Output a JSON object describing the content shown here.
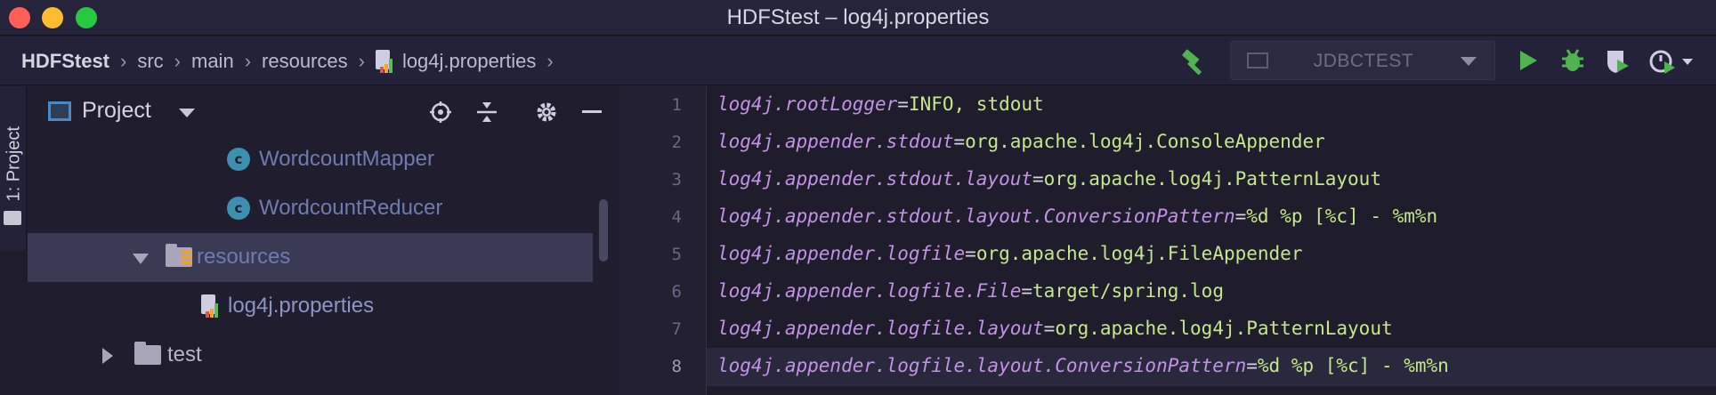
{
  "window": {
    "title": "HDFStest – log4j.properties"
  },
  "breadcrumb": {
    "items": [
      "HDFStest",
      "src",
      "main",
      "resources",
      "log4j.properties"
    ]
  },
  "toolbar": {
    "run_config_label": "JDBCTEST",
    "icons": [
      "build-hammer-icon",
      "run-icon",
      "debug-icon",
      "coverage-icon",
      "profile-icon"
    ]
  },
  "tool_strip": {
    "label": "1: Project"
  },
  "project_panel": {
    "title": "Project",
    "header_icons": [
      "locate-icon",
      "collapse-icon",
      "settings-gear-icon",
      "hide-icon"
    ],
    "tree": [
      {
        "label": "WordcountMapper",
        "kind": "class",
        "badge": "c"
      },
      {
        "label": "WordcountReducer",
        "kind": "class",
        "badge": "c"
      },
      {
        "label": "resources",
        "kind": "folder",
        "expanded": true,
        "selected": true
      },
      {
        "label": "log4j.properties",
        "kind": "properties-file"
      },
      {
        "label": "test",
        "kind": "folder",
        "expanded": false
      }
    ]
  },
  "editor": {
    "current_line": 8,
    "lines": [
      {
        "num": "1",
        "key": "log4j.rootLogger",
        "value": "INFO, stdout"
      },
      {
        "num": "2",
        "key": "log4j.appender.stdout",
        "value": "org.apache.log4j.ConsoleAppender"
      },
      {
        "num": "3",
        "key": "log4j.appender.stdout.layout",
        "value": "org.apache.log4j.PatternLayout"
      },
      {
        "num": "4",
        "key": "log4j.appender.stdout.layout.ConversionPattern",
        "value": "%d %p [%c] - %m%n"
      },
      {
        "num": "5",
        "key": "log4j.appender.logfile",
        "value": "org.apache.log4j.FileAppender"
      },
      {
        "num": "6",
        "key": "log4j.appender.logfile.File",
        "value": "target/spring.log"
      },
      {
        "num": "7",
        "key": "log4j.appender.logfile.layout",
        "value": "org.apache.log4j.PatternLayout"
      },
      {
        "num": "8",
        "key": "log4j.appender.logfile.layout.ConversionPattern",
        "value": "%d %p [%c] - %m%n"
      }
    ]
  },
  "colors": {
    "background": "#1f1d2b",
    "key": "#c392e8",
    "value": "#c4e78a",
    "selection": "#3a3a55",
    "run_green": "#4fb34f"
  }
}
